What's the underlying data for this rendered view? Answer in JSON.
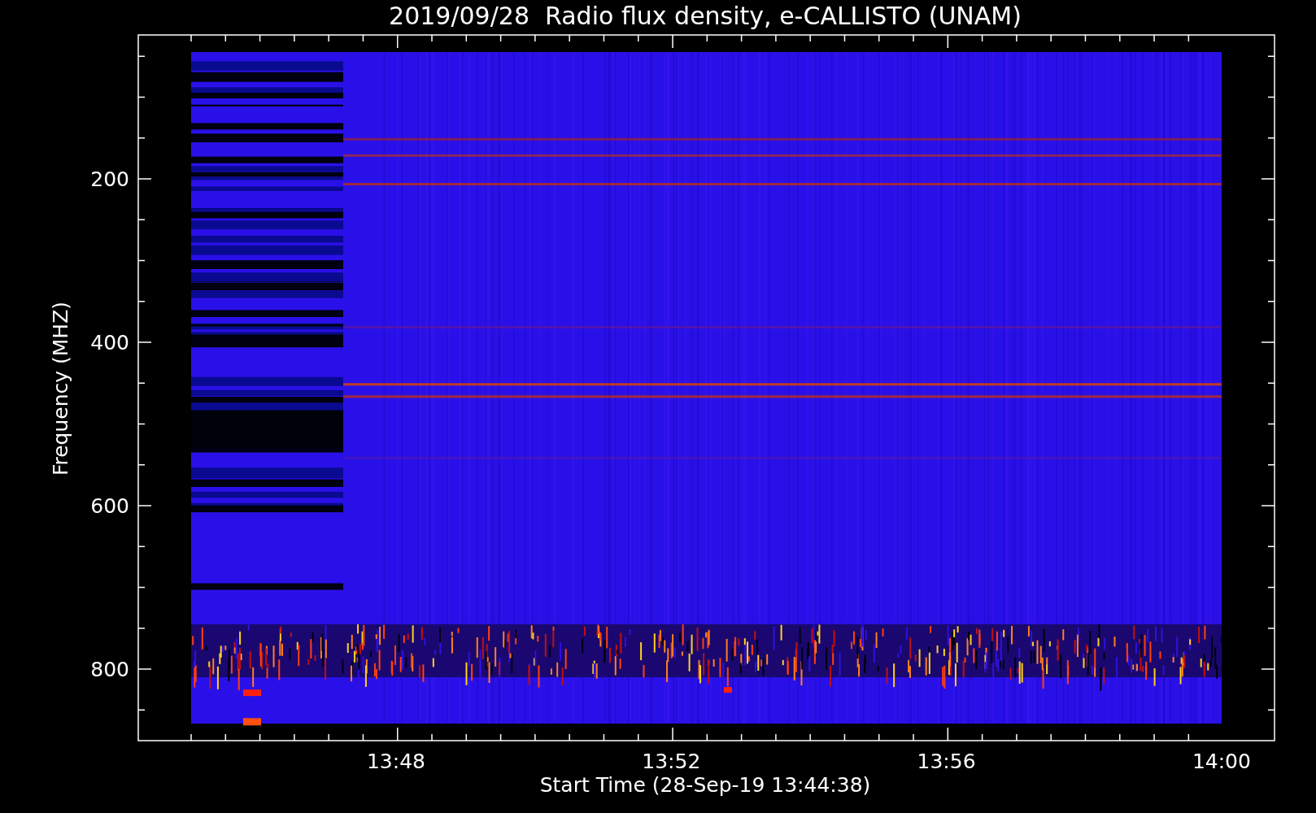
{
  "title": "2019/09/28  Radio flux density, e-CALLISTO (UNAM)",
  "y_axis": {
    "label": "Frequency (MHZ)",
    "ticks": [
      "200",
      "400",
      "600",
      "800"
    ]
  },
  "x_axis": {
    "label": "Start Time (28-Sep-19 13:44:38)",
    "ticks": [
      "13:48",
      "13:52",
      "13:56",
      "14:00"
    ]
  }
}
